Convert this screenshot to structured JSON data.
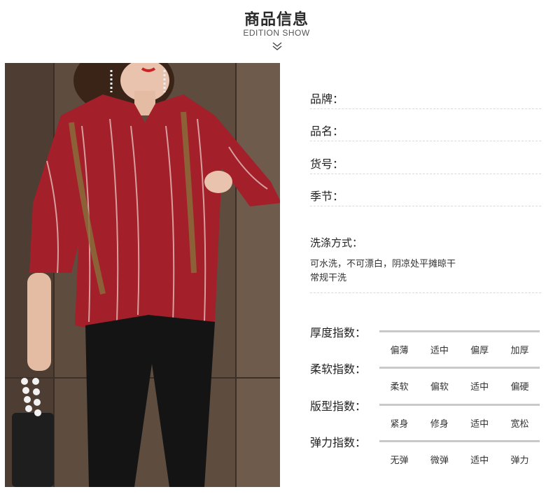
{
  "header": {
    "title": "商品信息",
    "subtitle": "EDITION SHOW"
  },
  "info": {
    "brand_label": "品牌：",
    "name_label": "品名：",
    "sku_label": "货号：",
    "season_label": "季节："
  },
  "washing": {
    "title": "洗涤方式：",
    "line1": "可水洗，不可漂白，阴凉处平摊晾干",
    "line2": "常规干洗"
  },
  "indices": [
    {
      "label": "厚度指数：",
      "options": [
        "偏薄",
        "适中",
        "偏厚",
        "加厚"
      ]
    },
    {
      "label": "柔软指数：",
      "options": [
        "柔软",
        "偏软",
        "适中",
        "偏硬"
      ]
    },
    {
      "label": "版型指数：",
      "options": [
        "紧身",
        "修身",
        "适中",
        "宽松"
      ]
    },
    {
      "label": "弹力指数：",
      "options": [
        "无弹",
        "微弹",
        "适中",
        "弹力"
      ]
    }
  ],
  "colors": {
    "blouse": "#a3202b",
    "trousers": "#141414",
    "background": "#ffffff"
  }
}
